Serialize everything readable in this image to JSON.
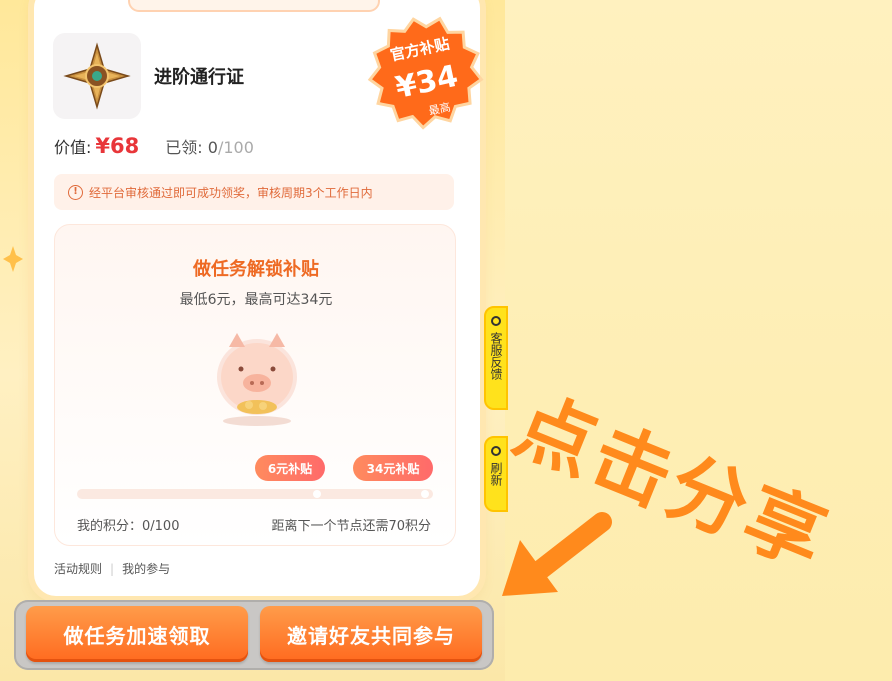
{
  "product": {
    "name": "进阶通行证",
    "value_label": "价值:",
    "price": "¥68",
    "claimed_label": "已领:",
    "claimed_count": "0",
    "claimed_total": "/100",
    "icon": "compass-medal-icon"
  },
  "badge": {
    "title": "官方补贴",
    "amount": "¥34",
    "note": "最高",
    "color": "#ff6a1a"
  },
  "notice": {
    "text": "经平台审核通过即可成功领奖，审核周期3个工作日内",
    "icon": "info-circle-icon"
  },
  "task": {
    "title": "做任务解锁补贴",
    "subtitle": "最低6元，最高可达34元",
    "milestones": [
      {
        "label": "6元补贴"
      },
      {
        "label": "34元补贴"
      }
    ],
    "progress": 0.0,
    "points_label": "我的积分：0/100",
    "remaining_label": "距离下一个节点还需70积分"
  },
  "links": {
    "rules": "活动规则",
    "separator": "|",
    "participation": "我的参与"
  },
  "buttons": {
    "task_accelerate": "做任务加速领取",
    "invite_friends": "邀请好友共同参与"
  },
  "side_tabs": [
    {
      "label": "客服反馈",
      "icon": "headset-icon"
    },
    {
      "label": "刷新",
      "icon": "refresh-icon"
    }
  ],
  "overlay": {
    "text": "点击分享",
    "color": "#ff8a1c"
  }
}
